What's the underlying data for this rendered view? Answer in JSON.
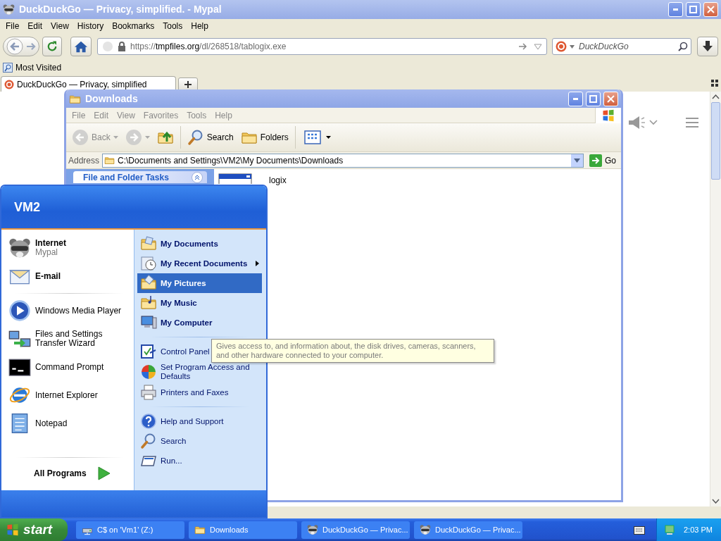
{
  "browser": {
    "title": "DuckDuckGo — Privacy, simplified. - Mypal",
    "menu": [
      "File",
      "Edit",
      "View",
      "History",
      "Bookmarks",
      "Tools",
      "Help"
    ],
    "url": {
      "prefix": "https://",
      "host": "tmpfiles.org",
      "path": "/dl/268518/tablogix.exe"
    },
    "search": {
      "placeholder": "DuckDuckGo"
    },
    "bookmarks": [
      "Most Visited"
    ],
    "tabs": [
      {
        "label": "DuckDuckGo — Privacy, simplified",
        "selected": true
      }
    ]
  },
  "explorer": {
    "title": "Downloads",
    "menu": [
      "File",
      "Edit",
      "View",
      "Favorites",
      "Tools",
      "Help"
    ],
    "toolbar": [
      {
        "kind": "back",
        "label": "Back",
        "disabled": true
      },
      {
        "kind": "forward",
        "disabled": true
      },
      {
        "kind": "up",
        "disabled": false
      },
      {
        "kind": "search",
        "label": "Search",
        "disabled": false
      },
      {
        "kind": "folders",
        "label": "Folders",
        "disabled": false
      },
      {
        "kind": "views",
        "disabled": false
      }
    ],
    "address": {
      "label": "Address",
      "value": "C:\\Documents and Settings\\VM2\\My Documents\\Downloads",
      "go": "Go"
    },
    "task_panes": [
      "File and Folder Tasks"
    ],
    "files": [
      {
        "name": "logix"
      }
    ]
  },
  "start_menu": {
    "user": "VM2",
    "programs": [
      [
        {
          "kind": "internet",
          "title": "Internet",
          "subtitle": "Mypal"
        },
        {
          "kind": "email",
          "title": "E-mail"
        }
      ],
      [
        {
          "kind": "media",
          "title": "Windows Media Player"
        },
        {
          "kind": "transfer",
          "title": "Files and Settings Transfer Wizard"
        },
        {
          "kind": "console",
          "title": "Command Prompt"
        },
        {
          "kind": "ie",
          "title": "Internet Explorer"
        },
        {
          "kind": "notes",
          "title": "Notepad"
        }
      ]
    ],
    "all_programs": "All Programs",
    "places": [
      [
        {
          "kind": "documents",
          "label": "My Documents",
          "selected": false,
          "submenu": false
        },
        {
          "kind": "recent",
          "label": "My Recent Documents",
          "selected": false,
          "submenu": true
        },
        {
          "kind": "pictures",
          "label": "My Pictures",
          "selected": true,
          "submenu": false
        },
        {
          "kind": "music",
          "label": "My Music",
          "selected": false,
          "submenu": false
        },
        {
          "kind": "computer",
          "label": "My Computer",
          "selected": false,
          "submenu": false
        }
      ],
      [
        {
          "kind": "control",
          "label": "Control Panel",
          "selected": false,
          "submenu": false
        },
        {
          "kind": "defaults",
          "label": "Set Program Access and Defaults",
          "selected": false,
          "submenu": false
        },
        {
          "kind": "printer",
          "label": "Printers and Faxes",
          "selected": false,
          "submenu": false
        }
      ],
      [
        {
          "kind": "help",
          "label": "Help and Support",
          "selected": false,
          "submenu": false
        },
        {
          "kind": "search",
          "label": "Search",
          "selected": false,
          "submenu": false
        },
        {
          "kind": "run",
          "label": "Run...",
          "selected": false,
          "submenu": false
        }
      ]
    ]
  },
  "tooltip": "Gives access to, and information about, the disk drives, cameras, scanners, and other hardware connected to your computer.",
  "taskbar": {
    "start": "start",
    "tasks": [
      {
        "kind": "drive",
        "label": "C$ on 'Vm1' (Z:)"
      },
      {
        "kind": "folder",
        "label": "Downloads"
      },
      {
        "kind": "browser",
        "label": "DuckDuckGo — Privac..."
      },
      {
        "kind": "browser",
        "label": "DuckDuckGo — Privac..."
      }
    ],
    "clock": "2:03 PM"
  }
}
